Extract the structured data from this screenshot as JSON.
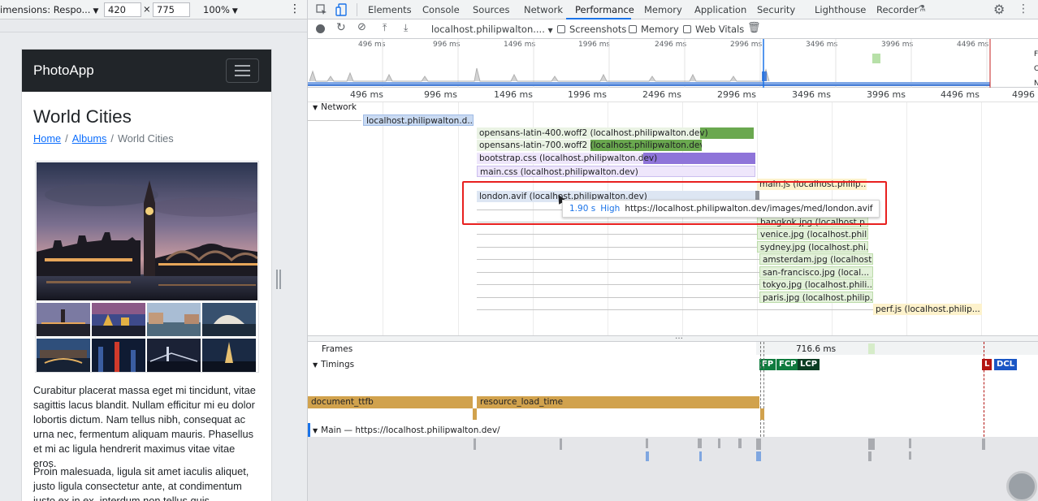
{
  "device_toolbar": {
    "dimensions_label": "imensions: Respo...",
    "width": "420",
    "height": "775",
    "zoom": "100%",
    "times": "×"
  },
  "app": {
    "brand": "PhotoApp",
    "page_title": "World Cities",
    "breadcrumbs": [
      {
        "label": "Home"
      },
      {
        "label": "Albums"
      },
      {
        "label": "World Cities"
      }
    ],
    "paragraph_1": "Curabitur placerat massa eget mi tincidunt, vitae sagittis lacus blandit. Nullam efficitur mi eu dolor lobortis dictum. Nam tellus nibh, consequat ac urna nec, fermentum aliquam mauris. Phasellus et mi ac ligula hendrerit maximus vitae vitae eros.",
    "paragraph_2": "Proin malesuada, ligula sit amet iaculis aliquet, justo ligula consectetur ante, at condimentum justo ex in ex. interdum non tellus quis, accumsan"
  },
  "devtools": {
    "tabs": [
      "Elements",
      "Console",
      "Sources",
      "Network",
      "Performance",
      "Memory",
      "Application",
      "Security",
      "Lighthouse",
      "Recorder"
    ],
    "active_tab": "Performance",
    "recording_url": "localhost.philipwalton....",
    "checkbox_screenshots": "Screenshots",
    "checkbox_memory": "Memory",
    "checkbox_web_vitals": "Web Vitals",
    "overview_ticks": [
      "496 ms",
      "996 ms",
      "1496 ms",
      "1996 ms",
      "2496 ms",
      "2996 ms",
      "3496 ms",
      "3996 ms",
      "4496 ms"
    ],
    "ruler_ticks": [
      "496 ms",
      "996 ms",
      "1496 ms",
      "1996 ms",
      "2496 ms",
      "2996 ms",
      "3496 ms",
      "3996 ms",
      "4496 ms",
      "4996"
    ],
    "network_label": "Network",
    "requests": [
      {
        "label": "localhost.philipwalton.d..."
      },
      {
        "label": "opensans-latin-400.woff2 (localhost.philipwalton.dev)"
      },
      {
        "label": "opensans-latin-700.woff2 (localhost.philipwalton.dev)"
      },
      {
        "label": "bootstrap.css (localhost.philipwalton.dev)"
      },
      {
        "label": "main.css (localhost.philipwalton.dev)"
      },
      {
        "label": "main.js (localhost.philip..."
      },
      {
        "label": "london.avif (localhost.philipwalton.dev)"
      },
      {
        "label": "bangkok.jpg (localhost.p..."
      },
      {
        "label": "venice.jpg (localhost.phili..."
      },
      {
        "label": "sydney.jpg (localhost.phi..."
      },
      {
        "label": "amsterdam.jpg (localhost.p..."
      },
      {
        "label": "san-francisco.jpg (local..."
      },
      {
        "label": "tokyo.jpg (localhost.phili..."
      },
      {
        "label": "paris.jpg (localhost.philip..."
      },
      {
        "label": "perf.js (localhost.philip..."
      }
    ],
    "tooltip": {
      "time": "1.90 s",
      "priority": "High",
      "url": "https://localhost.philipwalton.dev/images/med/london.avif"
    },
    "frames_label": "Frames",
    "frames_value": "716.6 ms",
    "timings_label": "Timings",
    "markers": [
      "FP",
      "FCP",
      "LCP",
      "L",
      "DCL"
    ],
    "user_timings": [
      "document_ttfb",
      "resource_load_time"
    ],
    "main_label": "Main — https://localhost.philipwalton.dev/"
  },
  "colors": {
    "doc_blue": "#c9daf2",
    "font_green": "#6aa84f",
    "css_purple": "#b39ddb",
    "js_yellow": "#fdf2cc",
    "img_green": "#d6ecc9",
    "timing_gold": "#d1a24d",
    "highlight_red": "#e8201f"
  }
}
